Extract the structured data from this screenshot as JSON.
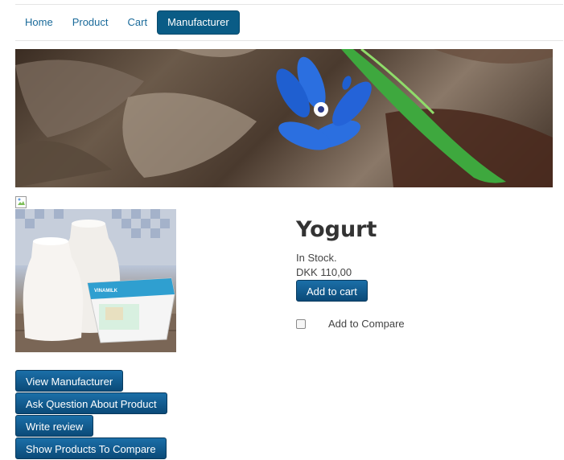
{
  "nav": {
    "items": [
      "Home",
      "Product",
      "Cart",
      "Manufacturer"
    ],
    "active": "Manufacturer"
  },
  "product": {
    "title": "Yogurt",
    "stock": "In Stock.",
    "price": "DKK 110,00",
    "add_to_cart": "Add to cart",
    "compare_label": "Add to Compare",
    "package_text": "VINAMILK"
  },
  "actions": [
    "View Manufacturer",
    "Ask Question About Product",
    "Write review",
    "Show Products To Compare"
  ],
  "colors": {
    "accent": "#0a5c86",
    "link": "#1a6a9a",
    "flower": "#2b6fe0"
  }
}
